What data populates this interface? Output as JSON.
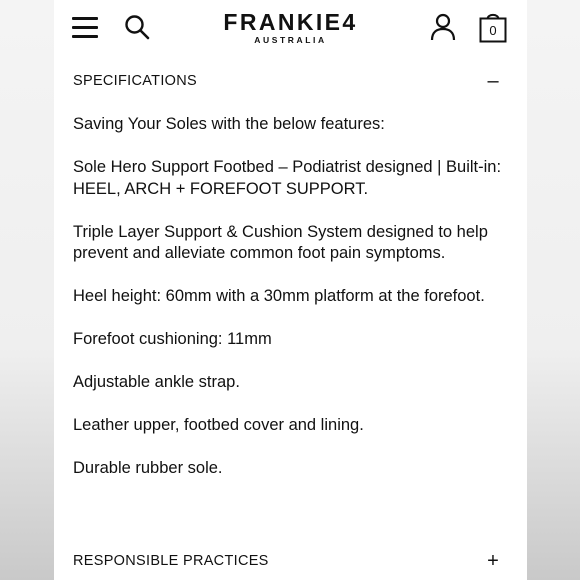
{
  "header": {
    "logo_main": "FRANKIE4",
    "logo_sub": "AUSTRALIA",
    "bag_count": "0"
  },
  "icons": {
    "menu": "hamburger-menu-icon",
    "search": "search-icon",
    "account": "account-icon",
    "bag": "shopping-bag-icon"
  },
  "specifications": {
    "title": "SPECIFICATIONS",
    "toggle": "–",
    "intro": "Saving Your Soles with the below features:",
    "feature_1_line_1": "Sole Hero Support Footbed – Podiatrist designed | Built-in:",
    "feature_1_line_2": "HEEL, ARCH + FOREFOOT SUPPORT.",
    "feature_2": "Triple Layer Support & Cushion System designed to help prevent and alleviate common foot pain symptoms.",
    "feature_3": "Heel height: 60mm with a 30mm platform at the forefoot.",
    "feature_4": "Forefoot cushioning: 11mm",
    "feature_5": "Adjustable ankle strap.",
    "feature_6": "Leather upper, footbed cover and lining.",
    "feature_7": "Durable rubber sole."
  },
  "responsible_practices": {
    "title": "RESPONSIBLE PRACTICES",
    "toggle": "+"
  },
  "colors": {
    "text": "#111111",
    "page": "#ffffff",
    "surround": "#f3f3f3"
  }
}
